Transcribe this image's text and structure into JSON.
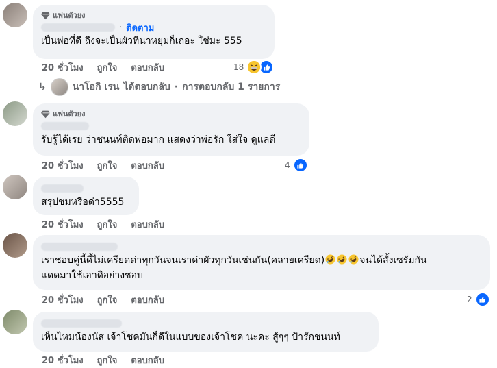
{
  "colors": {
    "bubble": "#f0f2f5",
    "link": "#0866ff",
    "muted": "#65676b",
    "like": "#0866ff"
  },
  "badge_label": "แฟนตัวยง",
  "actions": {
    "time": "20 ชั่วโมง",
    "like": "ถูกใจ",
    "reply": "ตอบกลับ"
  },
  "comments": [
    {
      "fan": true,
      "follow": "ติดตาม",
      "text": "เป็นพ่อที่ดี ถึงจะเป็นผัวที่น่าหยุมก็เถอะ ใช่มะ 555",
      "reactions": "18",
      "reaction_icons": [
        "haha-icon",
        "like-icon"
      ]
    },
    {
      "fan": true,
      "text": "รับรู้ได้เรย ว่าชนนท์ติดพ่อมาก แสดงว่าพ่อรัก ใส่ใจ ดูแลดี",
      "reactions": "4",
      "reaction_icons": [
        "like-icon"
      ]
    },
    {
      "fan": false,
      "text": "สรุปชมหรือด่า5555"
    },
    {
      "fan": false,
      "text_line1_a": "เราชอบคู่นี้ดี้ไม่เครียดด่าทุกวันจนเราด่าผัวทุกวันเช่นกัน(คลายเครียด)",
      "text_line1_b": "จนได้สั้งเซรั่มกัน",
      "text_line2": "แดดมาใช้เอาดิอย่างชอบ",
      "reactions": "2",
      "reaction_icons": [
        "like-icon"
      ],
      "inline_emoji": [
        "rofl-icon",
        "rofl-icon",
        "rofl-icon"
      ]
    },
    {
      "fan": false,
      "text": "เห็นไหมน้องนัส เจ้าโชคมันก็ดีในแบบของเจ้าโชค นะคะ สู้ๆๆ ป้ารักชนนท์"
    }
  ],
  "reply_summary": {
    "arrow": "↳",
    "name": "นาโอกิ เรน",
    "action": "ได้ตอบกลับ",
    "separator": "·",
    "count_text": "การตอบกลับ 1 รายการ"
  }
}
